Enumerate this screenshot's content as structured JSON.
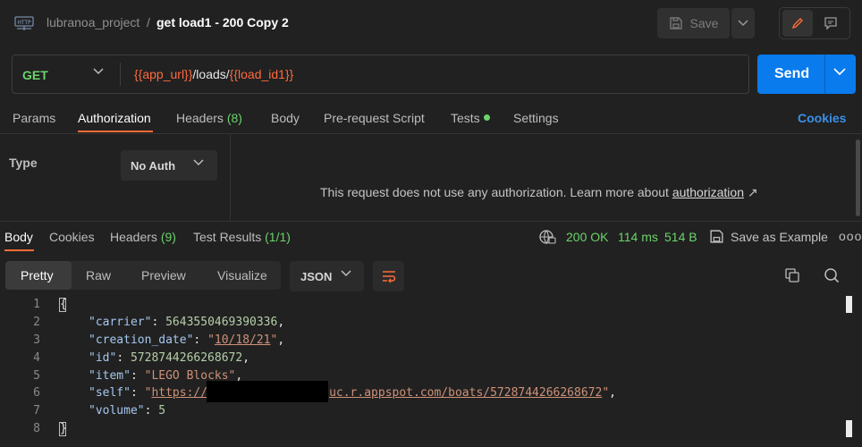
{
  "header": {
    "app_icon": "http-icon",
    "app_icon_text": "HTTP",
    "breadcrumb_project": "lubranoa_project",
    "breadcrumb_separator": "/",
    "request_name": "get load1 - 200 Copy 2",
    "save_label": "Save"
  },
  "request": {
    "method": "GET",
    "url_var1": "{{app_url}}",
    "url_mid": "/loads/",
    "url_var2": "{{load_id1}}",
    "send_label": "Send"
  },
  "request_tabs": {
    "params": "Params",
    "authorization": "Authorization",
    "headers": "Headers",
    "headers_count": "(8)",
    "body": "Body",
    "prerequest": "Pre-request Script",
    "tests": "Tests",
    "settings": "Settings",
    "cookies": "Cookies",
    "active": "Authorization"
  },
  "auth": {
    "type_label": "Type",
    "type_value": "No Auth",
    "message": "This request does not use any authorization. Learn more about ",
    "link": "authorization",
    "link_arrow": "↗"
  },
  "response_tabs": {
    "body": "Body",
    "cookies": "Cookies",
    "headers": "Headers",
    "headers_count": "(9)",
    "test_results": "Test Results",
    "test_count": "(1/1)",
    "active": "Body"
  },
  "response_status": {
    "code": "200 OK",
    "time": "114 ms",
    "size": "514 B",
    "save_example": "Save as Example",
    "more": "ooo"
  },
  "view": {
    "modes": [
      "Pretty",
      "Raw",
      "Preview",
      "Visualize"
    ],
    "active_mode": "Pretty",
    "language": "JSON"
  },
  "code": {
    "line_numbers": [
      "1",
      "2",
      "3",
      "4",
      "5",
      "6",
      "7",
      "8"
    ],
    "open_brace": "{",
    "close_brace": "}",
    "k_carrier": "\"carrier\"",
    "v_carrier": "5643550469390336",
    "k_creation": "\"creation_date\"",
    "v_creation_q1": "\"",
    "v_creation": "10/18/21",
    "v_creation_q2": "\"",
    "k_id": "\"id\"",
    "v_id": "5728744266268672",
    "k_item": "\"item\"",
    "v_item": "\"LEGO Blocks\"",
    "k_self": "\"self\"",
    "v_self_q1": "\"",
    "v_self_start": "https://",
    "v_self_end": "uc.r.appspot.com/boats/5728744266268672",
    "v_self_q2": "\"",
    "k_volume": "\"volume\"",
    "v_volume": "5",
    "colon": ": ",
    "comma": ","
  },
  "colors": {
    "accent": "#ff6c37",
    "send_blue": "#097bed",
    "success_green": "#6bd36b",
    "variable_orange": "#ff6a3d"
  }
}
